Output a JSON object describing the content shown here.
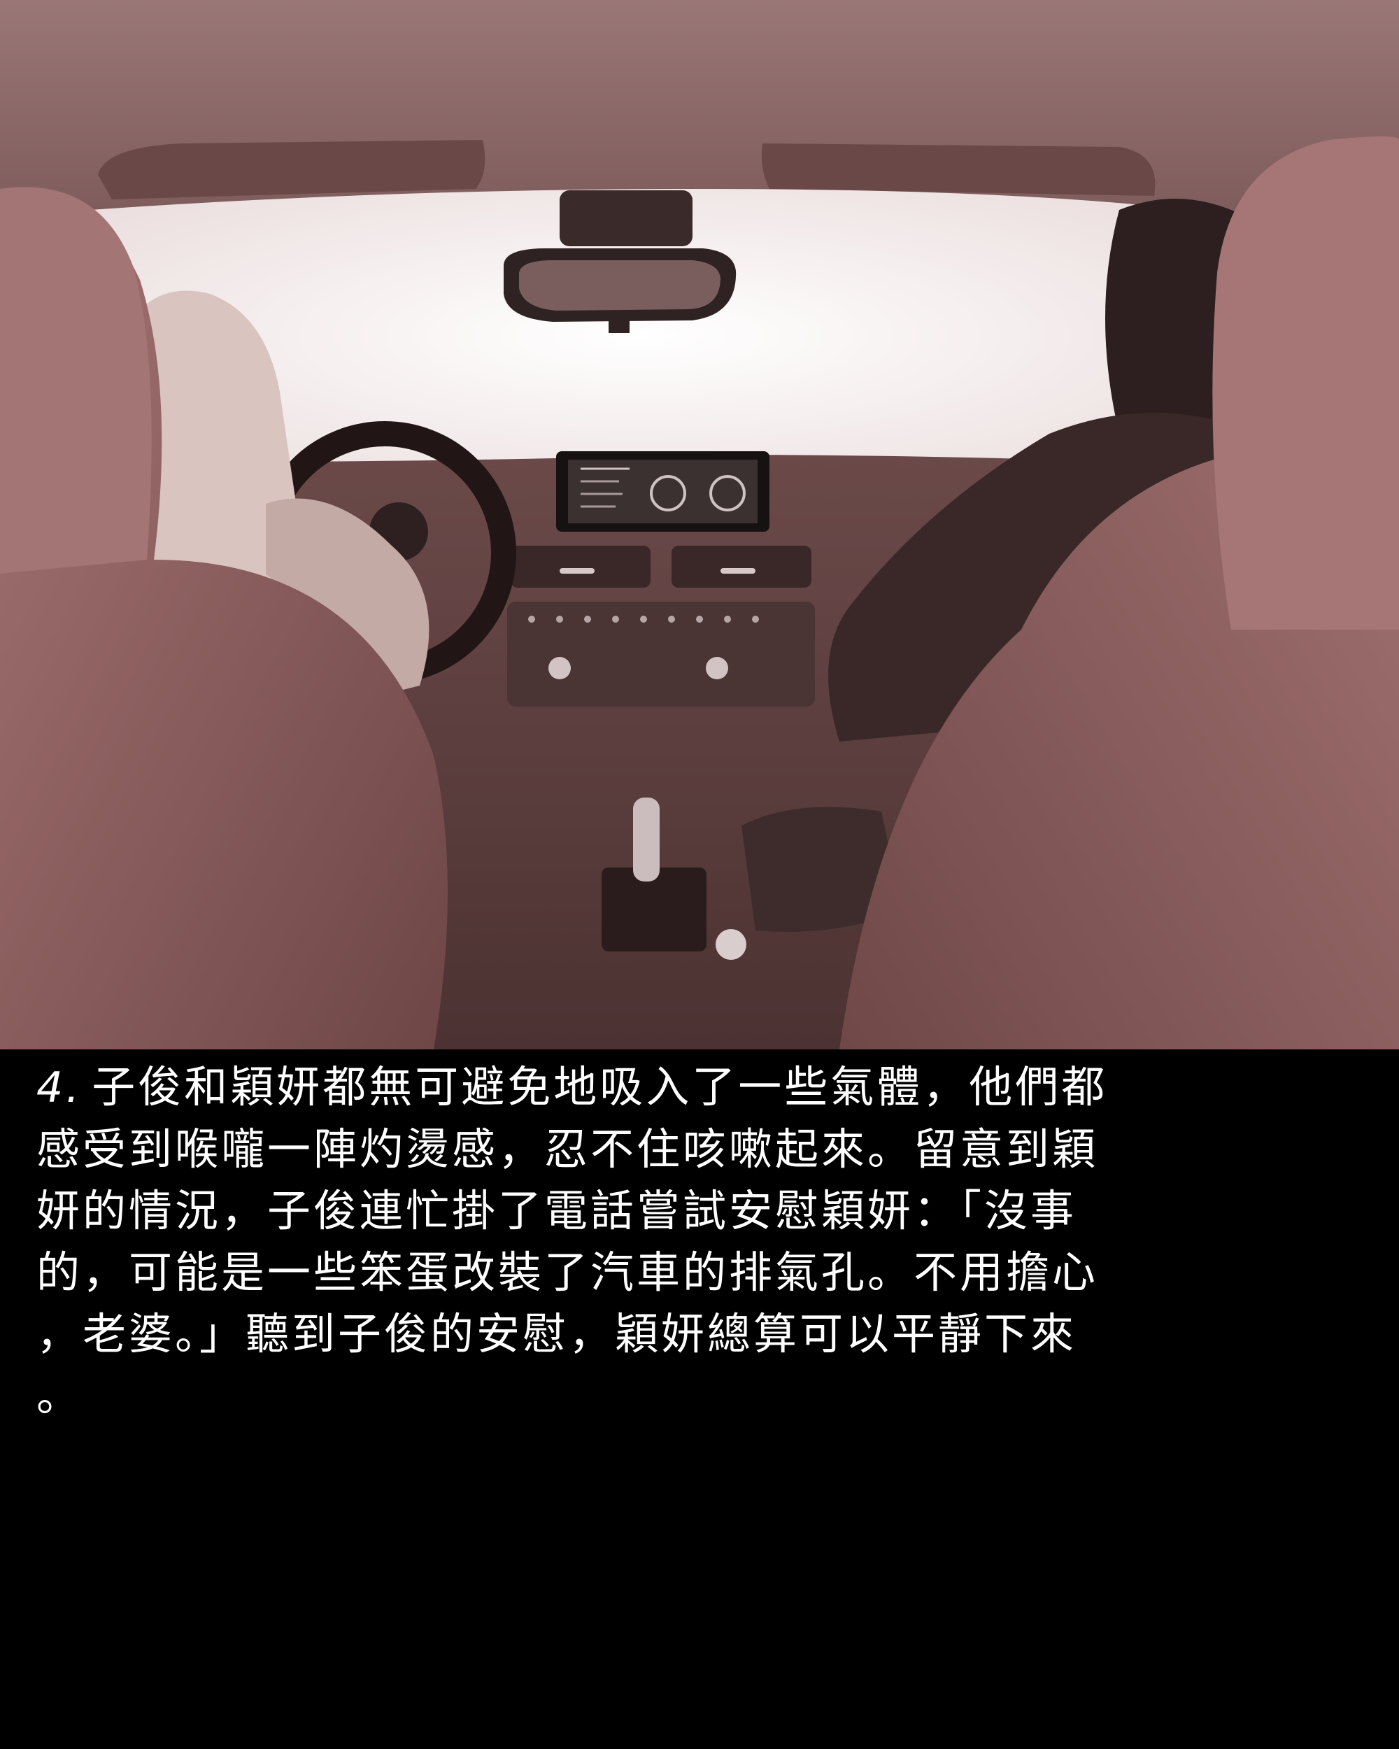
{
  "panel": {
    "image": {
      "subject": "car-interior-rear-view"
    },
    "caption": {
      "number": "4.",
      "lines": [
        "子俊和穎妍都無可避免地吸入了一些氣體，他們都",
        "感受到喉嚨一陣灼燙感，忍不住咳嗽起來。留意到穎",
        "妍的情況，子俊連忙掛了電話嘗試安慰穎妍：「沒事",
        "的，可能是一些笨蛋改裝了汽車的排氣孔。不用擔心",
        "，老婆。」聽到子俊的安慰，穎妍總算可以平靜下來",
        "。"
      ]
    }
  },
  "colors": {
    "caption_background": "#000000",
    "caption_text": "#ffffff",
    "scene_tint": "#8c6767",
    "windshield": "#f4ecec"
  }
}
